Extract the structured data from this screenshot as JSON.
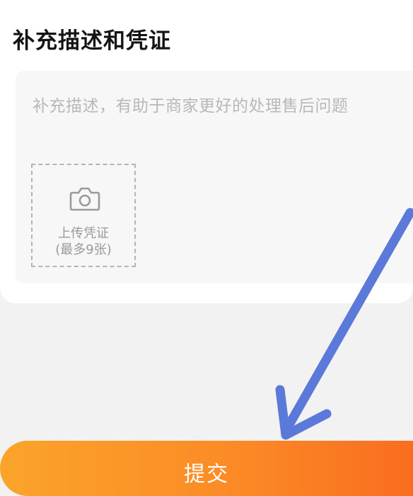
{
  "section": {
    "title": "补充描述和凭证"
  },
  "description": {
    "placeholder": "补充描述，有助于商家更好的处理售后问题"
  },
  "upload": {
    "label": "上传凭证",
    "limit": "(最多9张)",
    "icon": "camera-icon"
  },
  "submit": {
    "label": "提交"
  },
  "colors": {
    "accent_start": "#fba42a",
    "accent_end": "#fa6d20",
    "annotation_arrow": "#5b79d8"
  }
}
